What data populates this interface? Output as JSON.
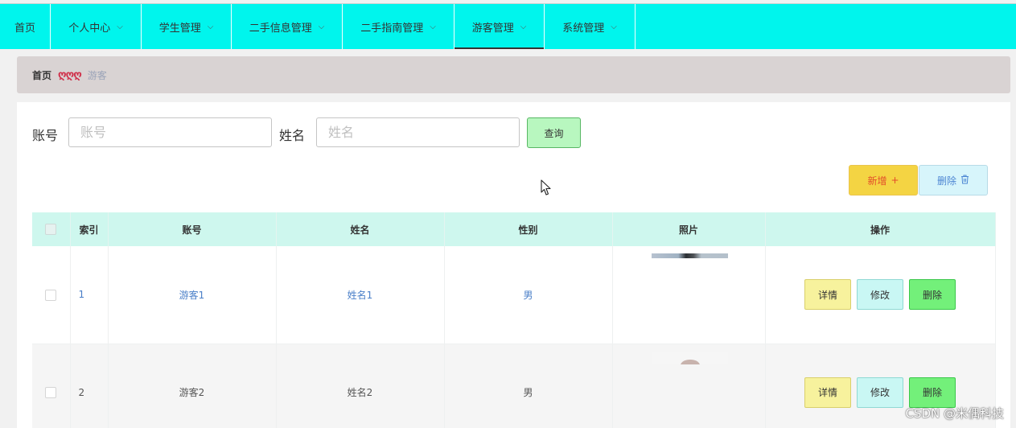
{
  "nav": {
    "items": [
      {
        "label": "首页",
        "dropdown": false,
        "active": false
      },
      {
        "label": "个人中心",
        "dropdown": true,
        "active": false
      },
      {
        "label": "学生管理",
        "dropdown": true,
        "active": false
      },
      {
        "label": "二手信息管理",
        "dropdown": true,
        "active": false
      },
      {
        "label": "二手指南管理",
        "dropdown": true,
        "active": false
      },
      {
        "label": "游客管理",
        "dropdown": true,
        "active": true
      },
      {
        "label": "系统管理",
        "dropdown": true,
        "active": false
      }
    ],
    "chevron": "⌵"
  },
  "breadcrumb": {
    "home": "首页",
    "separator": "ღღღ",
    "current": "游客"
  },
  "search": {
    "account_label": "账号",
    "account_placeholder": "账号",
    "name_label": "姓名",
    "name_placeholder": "姓名",
    "query_button": "查询"
  },
  "actions": {
    "add_label": "新增",
    "add_icon": "+",
    "delete_label": "删除",
    "delete_icon": "🗑"
  },
  "table": {
    "headers": [
      "",
      "索引",
      "账号",
      "姓名",
      "性别",
      "照片",
      "操作"
    ],
    "rows": [
      {
        "index": "1",
        "account": "游客1",
        "name": "姓名1",
        "gender": "男"
      },
      {
        "index": "2",
        "account": "游客2",
        "name": "姓名2",
        "gender": "男"
      }
    ],
    "op_labels": {
      "detail": "详情",
      "edit": "修改",
      "delete": "删除"
    }
  },
  "watermark": "CSDN @米偶科技",
  "colors": {
    "topbar": "#00f5ed",
    "header_row": "#cef7ee",
    "add_button": "#f4d443",
    "delete_button": "#d7f5fb",
    "query_button": "#b8f7bf"
  }
}
